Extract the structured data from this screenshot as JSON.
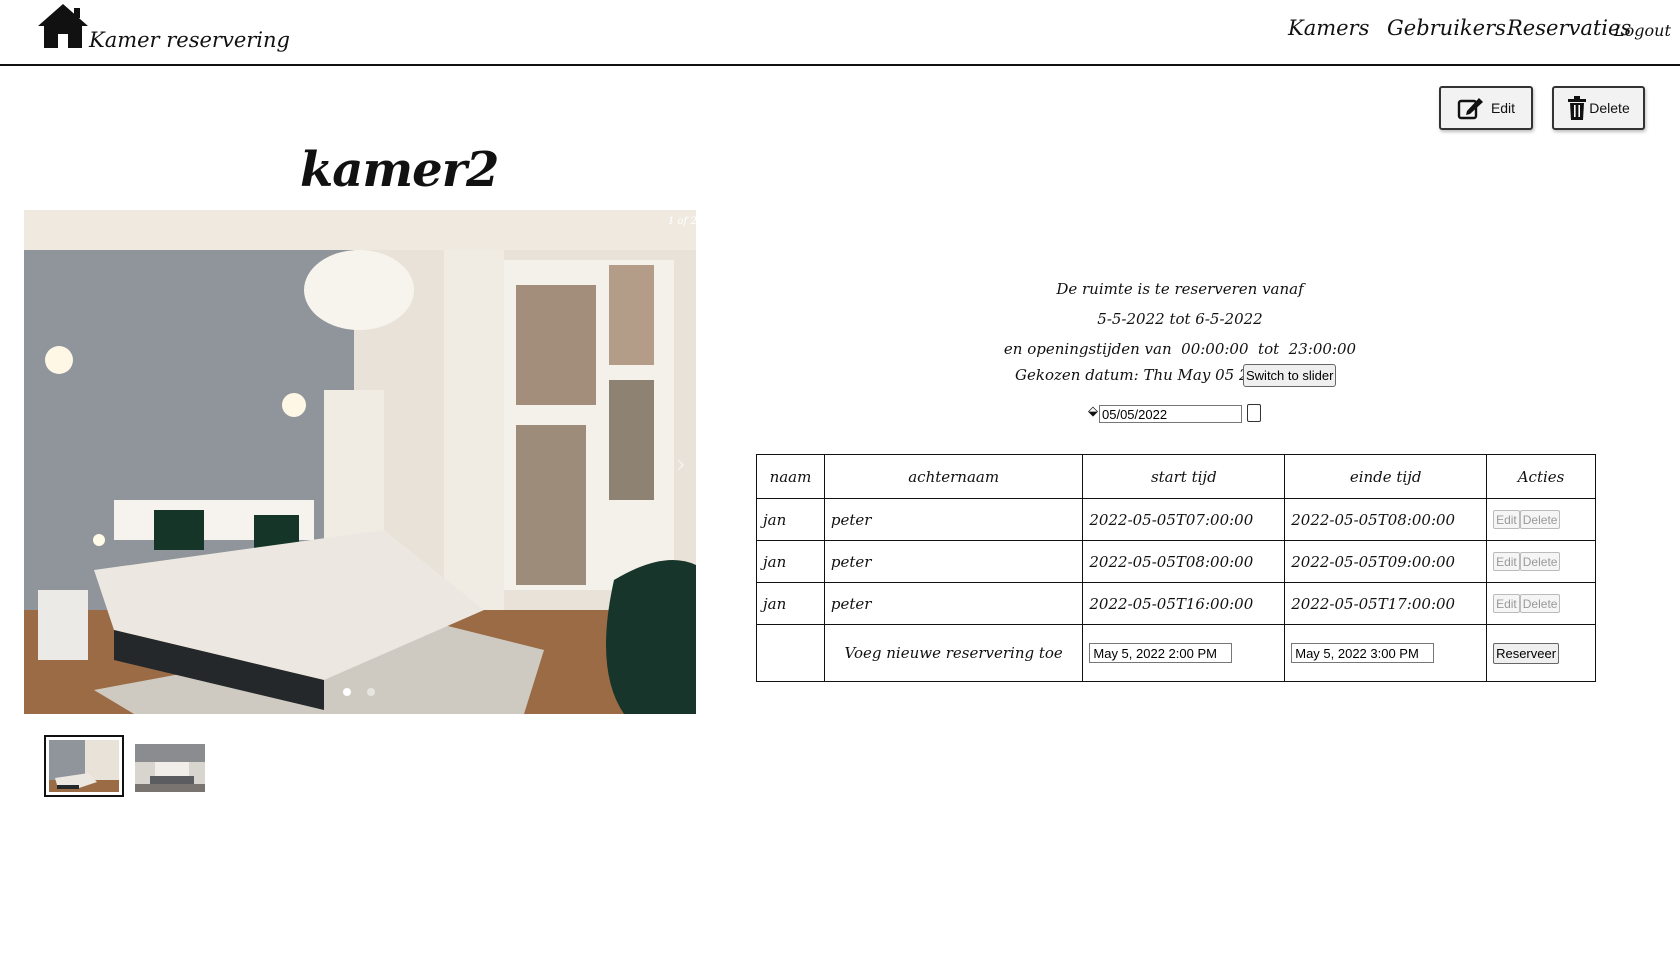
{
  "header": {
    "brand": "Kamer reservering",
    "nav": [
      {
        "label": "Kamers"
      },
      {
        "label": "Gebruikers"
      },
      {
        "label": "Reservaties"
      },
      {
        "label": "Logout"
      }
    ]
  },
  "actions": {
    "edit_label": "Edit",
    "delete_label": "Delete"
  },
  "room": {
    "title": "kamer2",
    "photo_counter": "1 of 2"
  },
  "availability": {
    "line1": "De ruimte is te reserveren vanaf",
    "line2": "5-5-2022 tot 6-5-2022",
    "line3": "en openingstijden van  00:00:00  tot  23:00:00",
    "chosen_date": "Gekozen datum: Thu May 05 2022",
    "switch_label": "Switch to slider",
    "date_value": "05/05/2022"
  },
  "table": {
    "headers": [
      "naam",
      "achternaam",
      "start tijd",
      "einde tijd",
      "Acties"
    ],
    "rows": [
      {
        "naam": "jan",
        "achternaam": "peter",
        "start": "2022-05-05T07:00:00",
        "einde": "2022-05-05T08:00:00"
      },
      {
        "naam": "jan",
        "achternaam": "peter",
        "start": "2022-05-05T08:00:00",
        "einde": "2022-05-05T09:00:00"
      },
      {
        "naam": "jan",
        "achternaam": "peter",
        "start": "2022-05-05T16:00:00",
        "einde": "2022-05-05T17:00:00"
      }
    ],
    "row_edit_label": "Edit",
    "row_delete_label": "Delete",
    "new_label": "Voeg nieuwe reservering toe",
    "new_start": "May 5, 2022 2:00 PM",
    "new_end": "May 5, 2022 3:00 PM",
    "reserve_label": "Reserveer"
  }
}
